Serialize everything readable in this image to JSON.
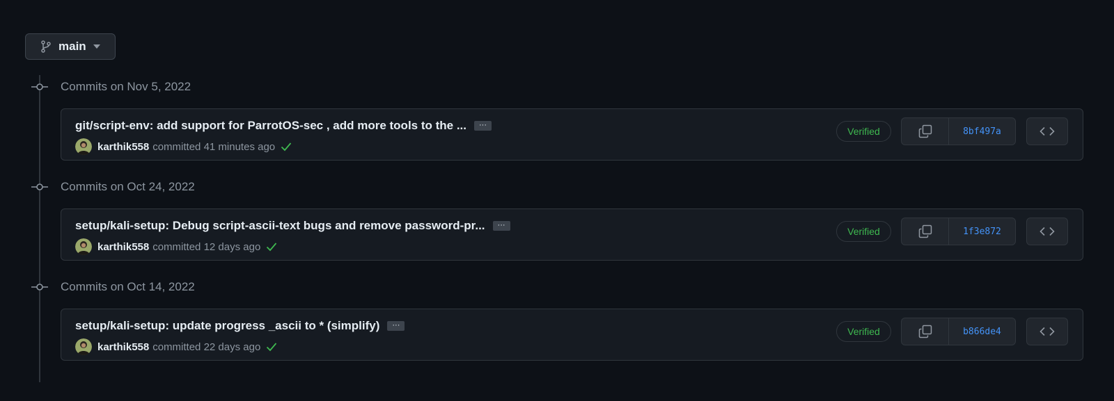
{
  "branch": {
    "name": "main",
    "icon": "git-branch-icon"
  },
  "groups": [
    {
      "date": "Commits on Nov 5, 2022",
      "commit": {
        "title": "git/script-env: add support for ParrotOS-sec , add more tools to the ...",
        "author": "karthik558",
        "committed_text": "committed 41 minutes ago",
        "verified": "Verified",
        "sha": "8bf497a"
      }
    },
    {
      "date": "Commits on Oct 24, 2022",
      "commit": {
        "title": "setup/kali-setup: Debug script-ascii-text bugs and remove password-pr...",
        "author": "karthik558",
        "committed_text": "committed 12 days ago",
        "verified": "Verified",
        "sha": "1f3e872"
      }
    },
    {
      "date": "Commits on Oct 14, 2022",
      "commit": {
        "title": "setup/kali-setup: update progress _ascii to * (simplify)",
        "author": "karthik558",
        "committed_text": "committed 22 days ago",
        "verified": "Verified",
        "sha": "b866de4"
      }
    }
  ],
  "ellipsis_label": "···",
  "colors": {
    "background": "#0d1117",
    "card": "#161b22",
    "border": "#30363d",
    "verified": "#3fb950",
    "sha_link": "#4493f8",
    "muted_text": "#8d96a0"
  }
}
